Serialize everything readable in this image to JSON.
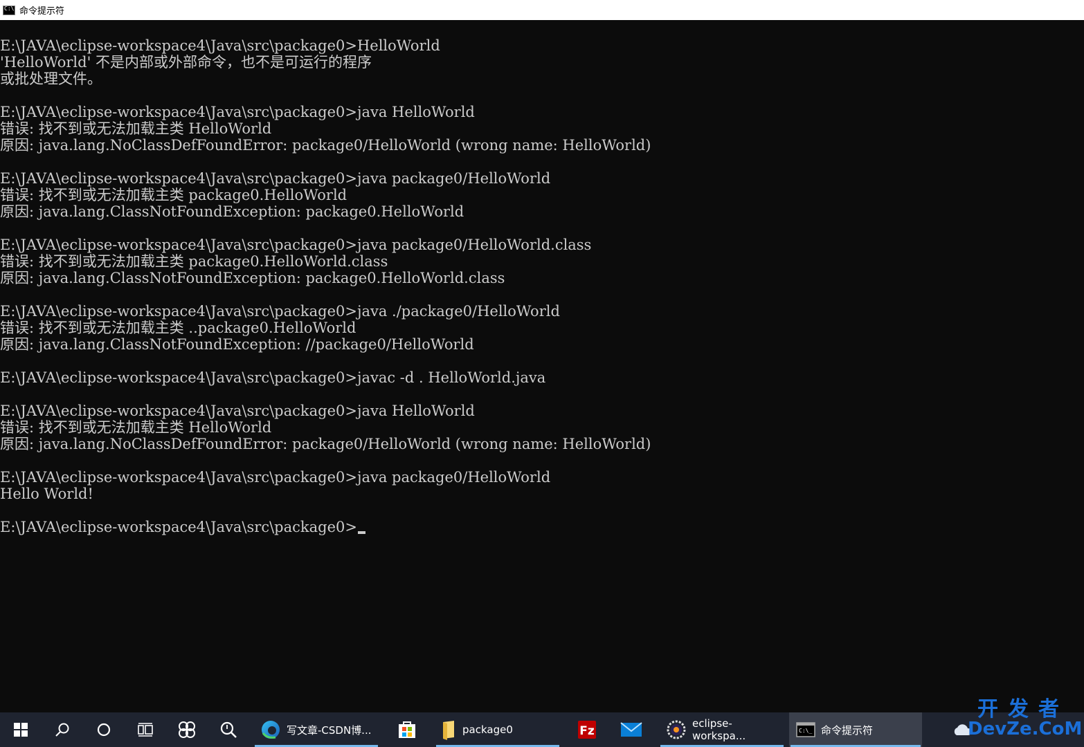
{
  "window": {
    "title": "命令提示符"
  },
  "console": {
    "lines": [
      "E:\\JAVA\\eclipse-workspace4\\Java\\src\\package0>HelloWorld",
      "'HelloWorld' 不是内部或外部命令，也不是可运行的程序",
      "或批处理文件。",
      "",
      "E:\\JAVA\\eclipse-workspace4\\Java\\src\\package0>java HelloWorld",
      "错误: 找不到或无法加载主类 HelloWorld",
      "原因: java.lang.NoClassDefFoundError: package0/HelloWorld (wrong name: HelloWorld)",
      "",
      "E:\\JAVA\\eclipse-workspace4\\Java\\src\\package0>java package0/HelloWorld",
      "错误: 找不到或无法加载主类 package0.HelloWorld",
      "原因: java.lang.ClassNotFoundException: package0.HelloWorld",
      "",
      "E:\\JAVA\\eclipse-workspace4\\Java\\src\\package0>java package0/HelloWorld.class",
      "错误: 找不到或无法加载主类 package0.HelloWorld.class",
      "原因: java.lang.ClassNotFoundException: package0.HelloWorld.class",
      "",
      "E:\\JAVA\\eclipse-workspace4\\Java\\src\\package0>java ./package0/HelloWorld",
      "错误: 找不到或无法加载主类 ..package0.HelloWorld",
      "原因: java.lang.ClassNotFoundException: //package0/HelloWorld",
      "",
      "E:\\JAVA\\eclipse-workspace4\\Java\\src\\package0>javac -d . HelloWorld.java",
      "",
      "E:\\JAVA\\eclipse-workspace4\\Java\\src\\package0>java HelloWorld",
      "错误: 找不到或无法加载主类 HelloWorld",
      "原因: java.lang.NoClassDefFoundError: package0/HelloWorld (wrong name: HelloWorld)",
      "",
      "E:\\JAVA\\eclipse-workspace4\\Java\\src\\package0>java package0/HelloWorld",
      "Hello World!",
      "",
      "E:\\JAVA\\eclipse-workspace4\\Java\\src\\package0>"
    ]
  },
  "taskbar": {
    "apps": [
      {
        "label": "写文章-CSDN博...",
        "icon": "edge-icon"
      },
      {
        "label": "",
        "icon": "store-icon"
      },
      {
        "label": "package0",
        "icon": "folder-icon"
      },
      {
        "label": "",
        "icon": "filezilla-icon"
      },
      {
        "label": "",
        "icon": "mail-icon"
      },
      {
        "label": "eclipse-workspa...",
        "icon": "eclipse-icon"
      },
      {
        "label": "命令提示符",
        "icon": "cmd-icon"
      }
    ],
    "colors": {
      "background": "#1f2430",
      "active": "#3b404c",
      "running_indicator": "#76b9ed"
    }
  },
  "watermark": {
    "cn": "开发者",
    "en": "DevZe.CoM"
  },
  "colors": {
    "console_bg": "#0c0c0c",
    "console_fg": "#cccccc"
  }
}
